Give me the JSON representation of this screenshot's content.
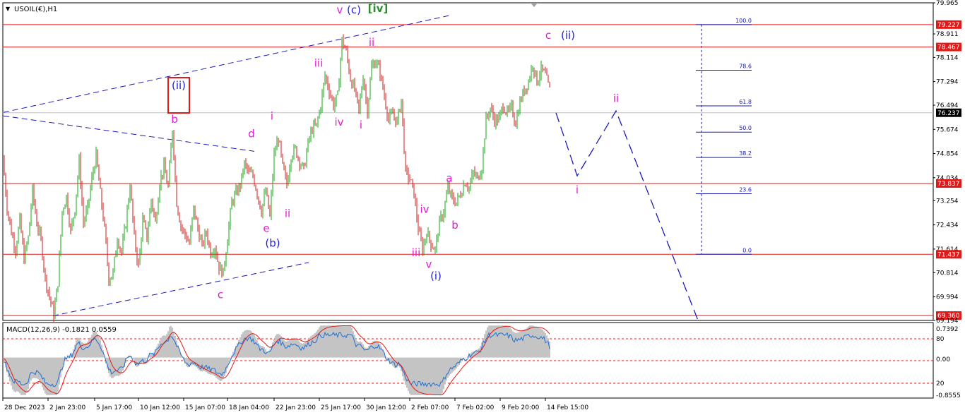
{
  "symbol_title": "USOIL(€),H1",
  "macd_title": "MACD(12,26,9) -0.1821 0.0559",
  "colors": {
    "bull": "#16a516",
    "bear": "#c81e1e",
    "hline": "#e01919",
    "trend": "#1a1ab8",
    "fib": "#1a1ab8",
    "wave_magenta": "#e619d2",
    "wave_blue": "#1f1fd6",
    "wave_green": "#2e8b2e",
    "macd_hist": "#c4c4c4",
    "macd_line": "#1f6fd6",
    "signal_line": "#e01919"
  },
  "chart_data": {
    "type": "candlestick",
    "ylim": [
      69.194,
      79.965
    ],
    "price_ticks": [
      "79.965",
      "79.227",
      "78.911",
      "78.467",
      "78.114",
      "77.294",
      "76.494",
      "76.237",
      "75.674",
      "74.854",
      "74.034",
      "73.837",
      "73.254",
      "72.434",
      "71.614",
      "71.437",
      "70.814",
      "69.994",
      "69.360",
      "69.194"
    ],
    "horizontal_levels": [
      {
        "value": 79.227,
        "label": "79.227"
      },
      {
        "value": 78.467,
        "label": "78.467"
      },
      {
        "value": 73.837,
        "label": "73.837"
      },
      {
        "value": 71.437,
        "label": "71.437"
      },
      {
        "value": 69.36,
        "label": "69.360"
      }
    ],
    "current_price": {
      "value": 76.237,
      "label": "76.237"
    },
    "time_labels": [
      "28 Dec 2023",
      "2 Jan 23:00",
      "5 Jan 17:00",
      "10 Jan 12:00",
      "15 Jan 07:00",
      "18 Jan 04:00",
      "22 Jan 23:00",
      "25 Jan 17:00",
      "30 Jan 12:00",
      "2 Feb 07:00",
      "7 Feb 02:00",
      "9 Feb 20:00",
      "14 Feb 15:00"
    ],
    "price_path": [
      [
        0,
        74.7
      ],
      [
        6,
        73.0
      ],
      [
        12,
        72.2
      ],
      [
        18,
        71.6
      ],
      [
        24,
        72.6
      ],
      [
        30,
        71.3
      ],
      [
        36,
        72.0
      ],
      [
        42,
        73.6
      ],
      [
        48,
        72.5
      ],
      [
        54,
        71.9
      ],
      [
        60,
        70.6
      ],
      [
        66,
        70.0
      ],
      [
        72,
        69.4
      ],
      [
        78,
        70.5
      ],
      [
        84,
        72.9
      ],
      [
        90,
        73.4
      ],
      [
        96,
        72.2
      ],
      [
        102,
        73.0
      ],
      [
        108,
        74.6
      ],
      [
        114,
        72.5
      ],
      [
        120,
        73.0
      ],
      [
        126,
        74.0
      ],
      [
        132,
        74.8
      ],
      [
        138,
        73.5
      ],
      [
        144,
        72.3
      ],
      [
        150,
        70.6
      ],
      [
        156,
        70.8
      ],
      [
        162,
        72.0
      ],
      [
        168,
        71.5
      ],
      [
        174,
        72.5
      ],
      [
        180,
        73.8
      ],
      [
        186,
        72.0
      ],
      [
        192,
        71.0
      ],
      [
        198,
        72.6
      ],
      [
        204,
        72.0
      ],
      [
        210,
        73.3
      ],
      [
        216,
        72.5
      ],
      [
        222,
        73.9
      ],
      [
        228,
        74.4
      ],
      [
        234,
        73.7
      ],
      [
        240,
        75.7
      ],
      [
        246,
        73.2
      ],
      [
        252,
        72.4
      ],
      [
        258,
        72.1
      ],
      [
        264,
        71.8
      ],
      [
        270,
        73.0
      ],
      [
        276,
        72.3
      ],
      [
        282,
        71.7
      ],
      [
        288,
        72.2
      ],
      [
        294,
        71.5
      ],
      [
        300,
        71.7
      ],
      [
        306,
        71.0
      ],
      [
        312,
        70.8
      ],
      [
        318,
        72.0
      ],
      [
        324,
        73.2
      ],
      [
        330,
        73.5
      ],
      [
        336,
        73.8
      ],
      [
        342,
        74.5
      ],
      [
        348,
        74.2
      ],
      [
        354,
        74.1
      ],
      [
        360,
        73.5
      ],
      [
        366,
        72.9
      ],
      [
        372,
        73.6
      ],
      [
        378,
        72.7
      ],
      [
        384,
        74.8
      ],
      [
        390,
        75.4
      ],
      [
        396,
        74.4
      ],
      [
        402,
        73.8
      ],
      [
        408,
        74.8
      ],
      [
        414,
        75.0
      ],
      [
        420,
        74.6
      ],
      [
        426,
        74.3
      ],
      [
        432,
        75.2
      ],
      [
        438,
        75.7
      ],
      [
        444,
        75.8
      ],
      [
        450,
        76.5
      ],
      [
        456,
        77.5
      ],
      [
        462,
        77.0
      ],
      [
        468,
        76.5
      ],
      [
        474,
        76.8
      ],
      [
        480,
        78.7
      ],
      [
        486,
        78.3
      ],
      [
        492,
        77.4
      ],
      [
        498,
        77.0
      ],
      [
        504,
        76.3
      ],
      [
        510,
        77.5
      ],
      [
        516,
        76.3
      ],
      [
        522,
        77.8
      ],
      [
        528,
        78.0
      ],
      [
        534,
        77.6
      ],
      [
        540,
        76.8
      ],
      [
        546,
        76.0
      ],
      [
        552,
        76.2
      ],
      [
        558,
        75.9
      ],
      [
        564,
        76.7
      ],
      [
        570,
        74.2
      ],
      [
        576,
        74.0
      ],
      [
        582,
        73.5
      ],
      [
        588,
        72.3
      ],
      [
        594,
        71.6
      ],
      [
        600,
        72.2
      ],
      [
        606,
        71.8
      ],
      [
        612,
        71.6
      ],
      [
        618,
        72.5
      ],
      [
        624,
        72.9
      ],
      [
        630,
        73.7
      ],
      [
        636,
        73.3
      ],
      [
        642,
        73.2
      ],
      [
        648,
        73.5
      ],
      [
        654,
        73.9
      ],
      [
        660,
        73.7
      ],
      [
        666,
        74.2
      ],
      [
        672,
        74.0
      ],
      [
        678,
        74.4
      ],
      [
        684,
        76.0
      ],
      [
        690,
        76.4
      ],
      [
        696,
        76.0
      ],
      [
        702,
        76.0
      ],
      [
        708,
        76.5
      ],
      [
        714,
        76.2
      ],
      [
        720,
        76.4
      ],
      [
        726,
        75.9
      ],
      [
        732,
        76.6
      ],
      [
        738,
        77.0
      ],
      [
        744,
        77.3
      ],
      [
        750,
        77.9
      ],
      [
        756,
        77.3
      ],
      [
        762,
        77.7
      ],
      [
        768,
        77.5
      ],
      [
        774,
        77.0
      ],
      [
        779,
        76.3
      ]
    ],
    "fib_levels": [
      {
        "label": "100.0",
        "value": 79.227
      },
      {
        "label": "78.6",
        "value": 77.68
      },
      {
        "label": "61.8",
        "value": 76.47
      },
      {
        "label": "50.0",
        "value": 75.58
      },
      {
        "label": "38.2",
        "value": 74.72
      },
      {
        "label": "23.6",
        "value": 73.49
      },
      {
        "label": "0.0",
        "value": 71.437
      }
    ],
    "wave_labels": [
      {
        "text": "v",
        "value": 79.6,
        "color": "magenta",
        "t": 481
      },
      {
        "text": "(c)",
        "value": 79.6,
        "color": "blue",
        "t": 501
      },
      {
        "text": "[iv]",
        "value": 79.65,
        "color": "green",
        "t": 535
      },
      {
        "text": "ii",
        "value": 78.5,
        "color": "magenta",
        "t": 526
      },
      {
        "text": "iii",
        "value": 77.8,
        "color": "magenta",
        "t": 451
      },
      {
        "text": "iv",
        "value": 75.8,
        "color": "magenta",
        "t": 480
      },
      {
        "text": "i",
        "value": 75.7,
        "color": "magenta",
        "t": 511
      },
      {
        "text": "c",
        "value": 78.75,
        "color": "magenta",
        "t": 776
      },
      {
        "text": "(ii)",
        "value": 78.75,
        "color": "blue",
        "t": 804
      },
      {
        "text": "ii",
        "value": 76.6,
        "color": "magenta",
        "t": 872
      },
      {
        "text": "i",
        "value": 73.5,
        "color": "magenta",
        "t": 817
      },
      {
        "text": "(ii)",
        "value": 77.04,
        "color": "blue",
        "t": 253
      },
      {
        "text": "b",
        "value": 75.9,
        "color": "magenta",
        "t": 247
      },
      {
        "text": "d",
        "value": 75.4,
        "color": "magenta",
        "t": 356
      },
      {
        "text": "i",
        "value": 76.0,
        "color": "magenta",
        "t": 385
      },
      {
        "text": "ii",
        "value": 72.7,
        "color": "magenta",
        "t": 407
      },
      {
        "text": "e",
        "value": 72.2,
        "color": "magenta",
        "t": 377
      },
      {
        "text": "(b)",
        "value": 71.7,
        "color": "blue",
        "t": 386
      },
      {
        "text": "c",
        "value": 69.95,
        "color": "magenta",
        "t": 312
      },
      {
        "text": "iv",
        "value": 72.85,
        "color": "magenta",
        "t": 601
      },
      {
        "text": "a",
        "value": 73.9,
        "color": "magenta",
        "t": 636
      },
      {
        "text": "b",
        "value": 72.3,
        "color": "magenta",
        "t": 644
      },
      {
        "text": "iii",
        "value": 71.37,
        "color": "magenta",
        "t": 589
      },
      {
        "text": "v",
        "value": 70.98,
        "color": "magenta",
        "t": 607
      },
      {
        "text": "(i)",
        "value": 70.58,
        "color": "blue",
        "t": 617
      }
    ],
    "projection": [
      [
        787,
        76.237
      ],
      [
        817,
        74.1
      ],
      [
        872,
        76.3
      ],
      [
        988,
        69.2
      ]
    ],
    "trendlines": [
      {
        "from": [
          5,
          76.25
        ],
        "to": [
          637,
          79.54
        ]
      },
      {
        "from": [
          5,
          76.13
        ],
        "to": [
          360,
          74.93
        ]
      },
      {
        "from": [
          75,
          69.35
        ],
        "to": [
          437,
          71.16
        ]
      }
    ],
    "macd": {
      "ylim": [
        -0.8555,
        0.7392
      ],
      "tick_labels": [
        "0.7392",
        "80",
        "0.00",
        "20",
        "-0.8555"
      ],
      "dashed_levels": [
        80,
        50,
        20
      ]
    }
  }
}
